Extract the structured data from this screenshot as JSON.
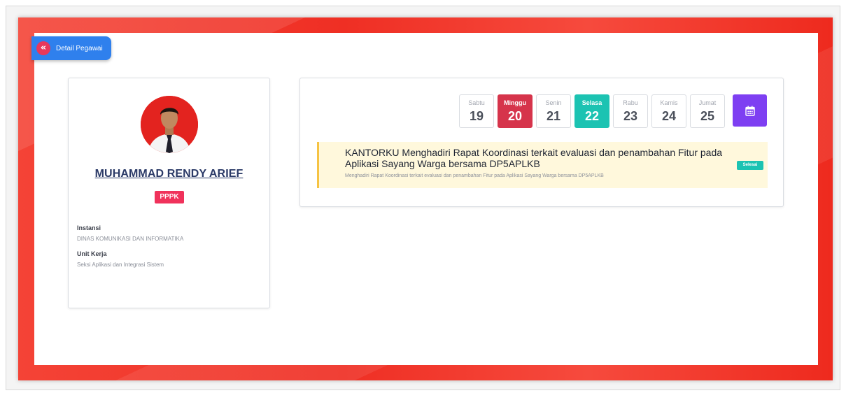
{
  "header": {
    "back_icon": "double-chevron-left-icon",
    "title": "Detail Pegawai"
  },
  "profile": {
    "avatar": "profile-photo",
    "name": "MUHAMMAD RENDY ARIEF",
    "type_badge": "PPPK",
    "instansi_label": "Instansi",
    "instansi_value": "DINAS KOMUNIKASI DAN INFORMATIKA",
    "unit_label": "Unit Kerja",
    "unit_value": "Seksi Aplikasi dan Integrasi Sistem"
  },
  "calendar": {
    "days": [
      {
        "name": "Sabtu",
        "date": "19",
        "state": "normal"
      },
      {
        "name": "Minggu",
        "date": "20",
        "state": "holiday"
      },
      {
        "name": "Senin",
        "date": "21",
        "state": "normal"
      },
      {
        "name": "Selasa",
        "date": "22",
        "state": "selected"
      },
      {
        "name": "Rabu",
        "date": "23",
        "state": "normal"
      },
      {
        "name": "Kamis",
        "date": "24",
        "state": "normal"
      },
      {
        "name": "Jumat",
        "date": "25",
        "state": "normal"
      }
    ],
    "button_icon": "calendar-icon"
  },
  "event": {
    "title": "KANTORKU Menghadiri Rapat Koordinasi terkait evaluasi dan penambahan Fitur pada Aplikasi Sayang Warga bersama DP5APLKB",
    "description": "Menghadiri Rapat Koordinasi terkait evaluasi dan penambahan Fitur pada Aplikasi Sayang Warga bersama DP5APLKB",
    "status": "Selesai"
  },
  "colors": {
    "frame_red": "#ef2f24",
    "header_blue": "#2f80ed",
    "badge_pink": "#f0325b",
    "holiday_red": "#d6344b",
    "selected_teal": "#1cc3b2",
    "calendar_purple": "#7e3ff2",
    "event_bg": "#fff8dc",
    "event_accent": "#f6c343"
  }
}
